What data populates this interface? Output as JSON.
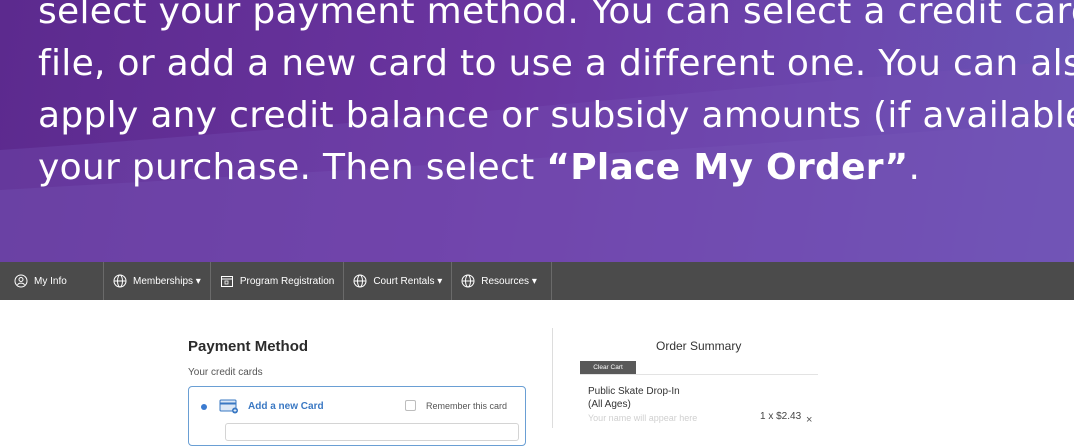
{
  "banner": {
    "line1": "select your payment method. You can select a credit card on",
    "line2": "file, or add a new card to use a different one. You can also",
    "line3": "apply any credit balance or subsidy amounts (if available) to",
    "line4_prefix": "your purchase.  Then select ",
    "line4_bold": "“Place My Order”",
    "line4_suffix": "."
  },
  "nav": {
    "items": [
      {
        "label": "My Info",
        "icon": "person-circle-icon"
      },
      {
        "label": "Memberships ▾",
        "icon": "globe-icon"
      },
      {
        "label": "Program Registration",
        "icon": "calendar-icon"
      },
      {
        "label": "Court Rentals ▾",
        "icon": "globe-icon"
      },
      {
        "label": "Resources ▾",
        "icon": "globe-icon"
      }
    ]
  },
  "payment": {
    "title": "Payment Method",
    "subtitle": "Your credit cards",
    "add_card_label": "Add a new Card",
    "remember_label": "Remember this card",
    "accent": "#3a78c3"
  },
  "order": {
    "title": "Order Summary",
    "clear_cart": "Clear Cart",
    "item": {
      "name_line1": "Public Skate Drop-In",
      "name_line2": "(All Ages)",
      "placeholder": "Your name will appear here",
      "qty_price": "1 x $2.43",
      "remove": "×"
    }
  }
}
